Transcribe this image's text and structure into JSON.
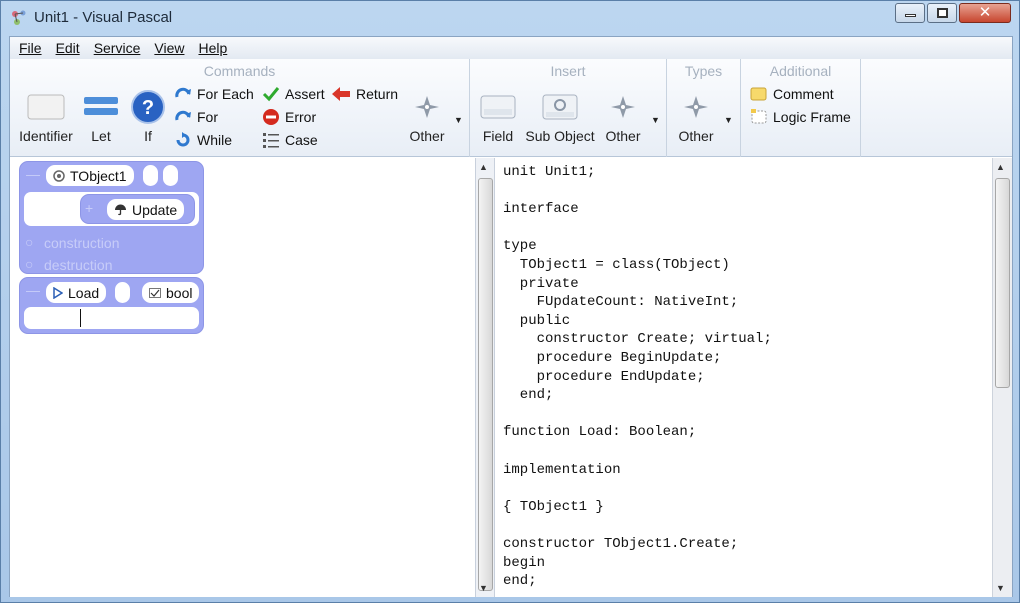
{
  "window": {
    "title": "Unit1 - Visual Pascal",
    "min_icon": "minimize-icon",
    "max_icon": "maximize-icon",
    "close_label": "✕"
  },
  "menu": [
    "File",
    "Edit",
    "Service",
    "View",
    "Help"
  ],
  "toolbar": {
    "groups": {
      "commands": "Commands",
      "insert": "Insert",
      "types": "Types",
      "additional": "Additional"
    },
    "commands": {
      "identifier": "Identifier",
      "let": "Let",
      "if": "If",
      "for_each": "For Each",
      "for": "For",
      "while": "While",
      "assert": "Assert",
      "error": "Error",
      "case": "Case",
      "return": "Return",
      "other": "Other"
    },
    "insert": {
      "field": "Field",
      "sub_object": "Sub Object",
      "other": "Other"
    },
    "types": {
      "other": "Other"
    },
    "additional": {
      "comment": "Comment",
      "logic_frame": "Logic Frame"
    }
  },
  "designer": {
    "class_block": {
      "name": "TObject1",
      "method": "Update",
      "construction": "construction",
      "destruction": "destruction"
    },
    "function_block": {
      "name": "Load",
      "type": "bool"
    }
  },
  "code": [
    "unit Unit1;",
    "",
    "interface",
    "",
    "type",
    "  TObject1 = class(TObject)",
    "  private",
    "    FUpdateCount: NativeInt;",
    "  public",
    "    constructor Create; virtual;",
    "    procedure BeginUpdate;",
    "    procedure EndUpdate;",
    "  end;",
    "",
    "function Load: Boolean;",
    "",
    "implementation",
    "",
    "{ TObject1 }",
    "",
    "constructor TObject1.Create;",
    "begin",
    "end;"
  ],
  "colors": {
    "block": "#9ea6f2",
    "accent": "#1e5ca8"
  }
}
